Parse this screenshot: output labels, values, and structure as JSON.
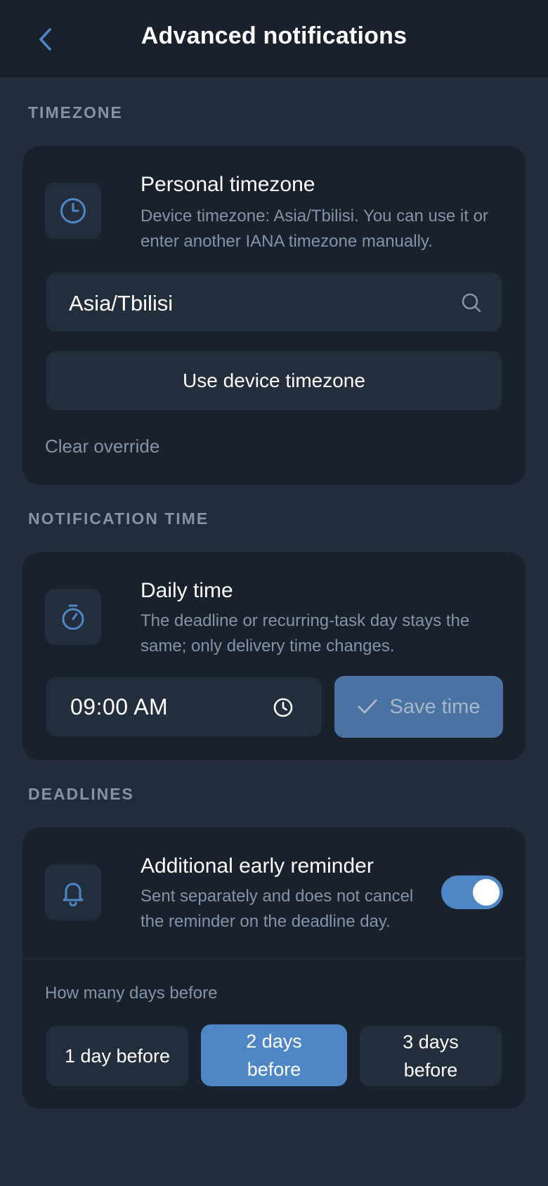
{
  "header": {
    "title": "Advanced notifications"
  },
  "timezone": {
    "section_label": "TIMEZONE",
    "title": "Personal timezone",
    "description": "Device timezone: Asia/Tbilisi. You can use it or enter another IANA timezone manually.",
    "input_value": "Asia/Tbilisi",
    "use_device_label": "Use device timezone",
    "clear_label": "Clear override"
  },
  "notification_time": {
    "section_label": "NOTIFICATION TIME",
    "title": "Daily time",
    "description": "The deadline or recurring-task day stays the same; only delivery time changes.",
    "time_value": "09:00 AM",
    "save_label": "Save time"
  },
  "deadlines": {
    "section_label": "DEADLINES",
    "title": "Additional early reminder",
    "description": "Sent separately and does not cancel the reminder on the deadline day.",
    "toggle_on": true,
    "days_label": "How many days before",
    "options": [
      "1 day before",
      "2 days before",
      "3 days before"
    ],
    "selected_index": 1
  },
  "colors": {
    "background": "#222c3a",
    "card": "#19212c",
    "accent": "#4f86c6",
    "muted_text": "#8593a6"
  }
}
